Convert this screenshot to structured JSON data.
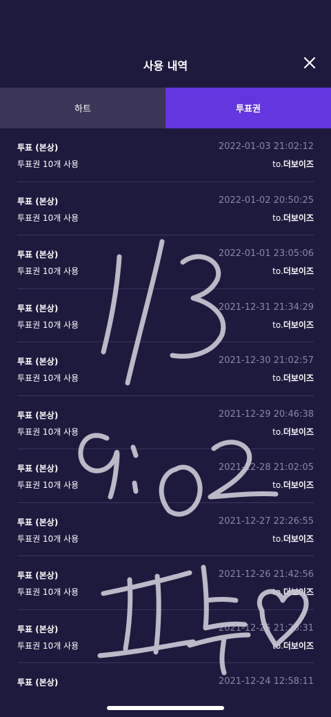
{
  "header": {
    "title": "사용 내역",
    "close_icon": "close-icon"
  },
  "tabs": [
    {
      "label": "하트",
      "selected": false
    },
    {
      "label": "투표권",
      "selected": true
    }
  ],
  "history": [
    {
      "title": "투표 (본상)",
      "date": "2022-01-03 21:02:12",
      "detail": "투표권 10개 사용",
      "to_prefix": "to.",
      "to_name": "더보이즈"
    },
    {
      "title": "투표 (본상)",
      "date": "2022-01-02 20:50:25",
      "detail": "투표권 10개 사용",
      "to_prefix": "to.",
      "to_name": "더보이즈"
    },
    {
      "title": "투표 (본상)",
      "date": "2022-01-01 23:05:06",
      "detail": "투표권 10개 사용",
      "to_prefix": "to.",
      "to_name": "더보이즈"
    },
    {
      "title": "투표 (본상)",
      "date": "2021-12-31 21:34:29",
      "detail": "투표권 10개 사용",
      "to_prefix": "to.",
      "to_name": "더보이즈"
    },
    {
      "title": "투표 (본상)",
      "date": "2021-12-30 21:02:57",
      "detail": "투표권 10개 사용",
      "to_prefix": "to.",
      "to_name": "더보이즈"
    },
    {
      "title": "투표 (본상)",
      "date": "2021-12-29 20:46:38",
      "detail": "투표권 10개 사용",
      "to_prefix": "to.",
      "to_name": "더보이즈"
    },
    {
      "title": "투표 (본상)",
      "date": "2021-12-28 21:02:05",
      "detail": "투표권 10개 사용",
      "to_prefix": "to.",
      "to_name": "더보이즈"
    },
    {
      "title": "투표 (본상)",
      "date": "2021-12-27 22:26:55",
      "detail": "투표권 10개 사용",
      "to_prefix": "to.",
      "to_name": "더보이즈"
    },
    {
      "title": "투표 (본상)",
      "date": "2021-12-26 21:42:56",
      "detail": "투표권 10개 사용",
      "to_prefix": "to.",
      "to_name": "더보이즈"
    },
    {
      "title": "투표 (본상)",
      "date": "2021-12-25 21:26:31",
      "detail": "투표권 10개 사용",
      "to_prefix": "to.",
      "to_name": "더보이즈"
    },
    {
      "title": "투표 (본상)",
      "date": "2021-12-24 12:58:11",
      "detail": "",
      "to_prefix": "",
      "to_name": ""
    }
  ],
  "colors": {
    "background": "#1e1a3d",
    "tab_inactive": "#3b3658",
    "tab_active": "#6336e0",
    "date_text": "#8a86a8",
    "handwriting": "#c9c7d4"
  }
}
